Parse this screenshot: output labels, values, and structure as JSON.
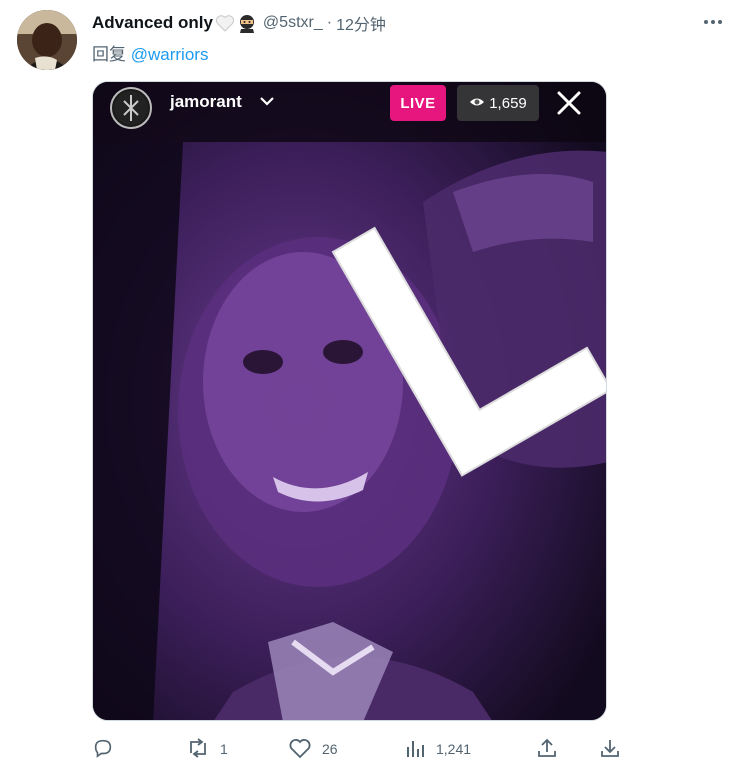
{
  "tweet": {
    "author_name": "Advanced only",
    "handle": "@5stxr_",
    "separator": "·",
    "time": "12分钟",
    "reply_prefix": "回复",
    "reply_to": "@warriors"
  },
  "media": {
    "username": "jamorant",
    "live_label": "LIVE",
    "viewer_count": "1,659",
    "overlay_letter": "L"
  },
  "actions": {
    "reply_count": "",
    "retweet_count": "1",
    "like_count": "26",
    "view_count": "1,241"
  },
  "icons": [
    "more-icon",
    "chevron-down-icon",
    "eye-icon",
    "close-icon",
    "reply-icon",
    "retweet-icon",
    "like-icon",
    "views-icon",
    "share-icon",
    "download-icon"
  ],
  "colors": {
    "accent": "#1d9bf0",
    "live": "#e6167e",
    "muted": "#536471"
  }
}
